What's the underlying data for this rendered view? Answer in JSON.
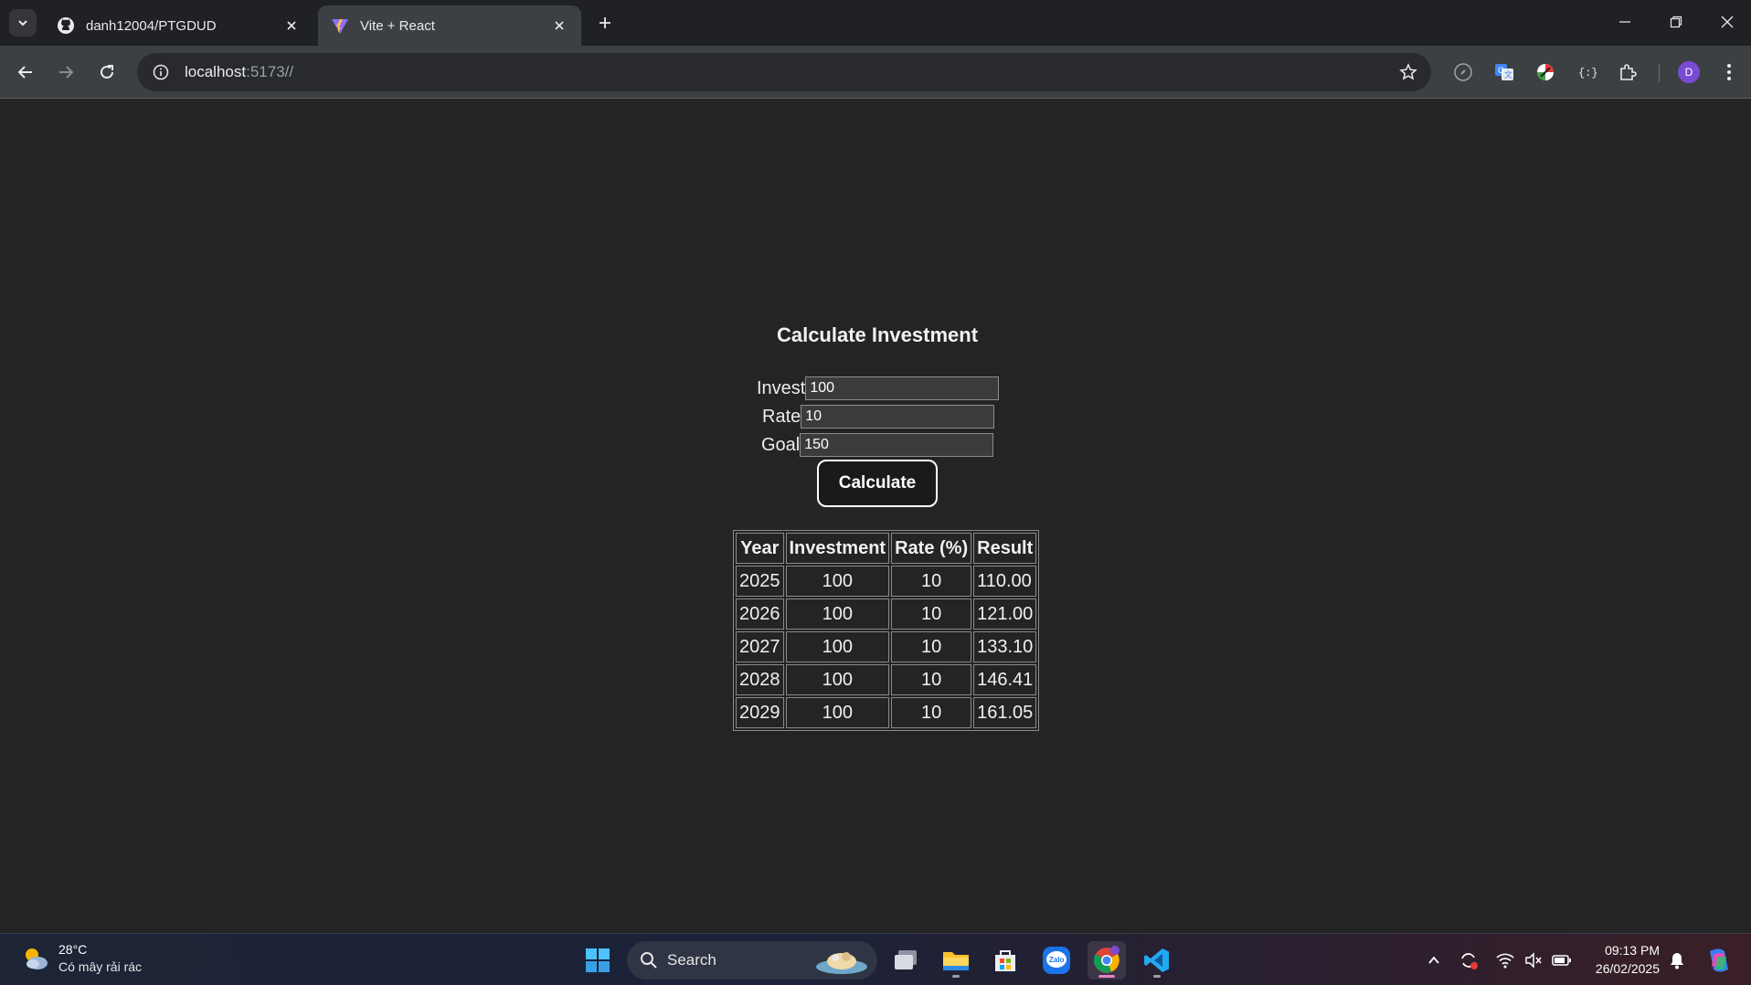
{
  "browser": {
    "tabs": [
      {
        "title": "danh12004/PTGDUD",
        "icon": "github-icon"
      },
      {
        "title": "Vite + React",
        "icon": "vite-icon"
      }
    ],
    "url_host": "localhost",
    "url_rest": ":5173//",
    "profile_initial": "D"
  },
  "app": {
    "title": "Calculate Investment",
    "fields": [
      {
        "label": "Invest",
        "value": "100"
      },
      {
        "label": "Rate",
        "value": "10"
      },
      {
        "label": "Goal",
        "value": "150"
      }
    ],
    "button_label": "Calculate",
    "table": {
      "headers": [
        "Year",
        "Investment",
        "Rate (%)",
        "Result"
      ],
      "rows": [
        [
          "2025",
          "100",
          "10",
          "110.00"
        ],
        [
          "2026",
          "100",
          "10",
          "121.00"
        ],
        [
          "2027",
          "100",
          "10",
          "133.10"
        ],
        [
          "2028",
          "100",
          "10",
          "146.41"
        ],
        [
          "2029",
          "100",
          "10",
          "161.05"
        ]
      ]
    }
  },
  "taskbar": {
    "weather_temp": "28°C",
    "weather_desc": "Có mây rải rác",
    "search_label": "Search",
    "time": "09:13 PM",
    "date": "26/02/2025"
  }
}
